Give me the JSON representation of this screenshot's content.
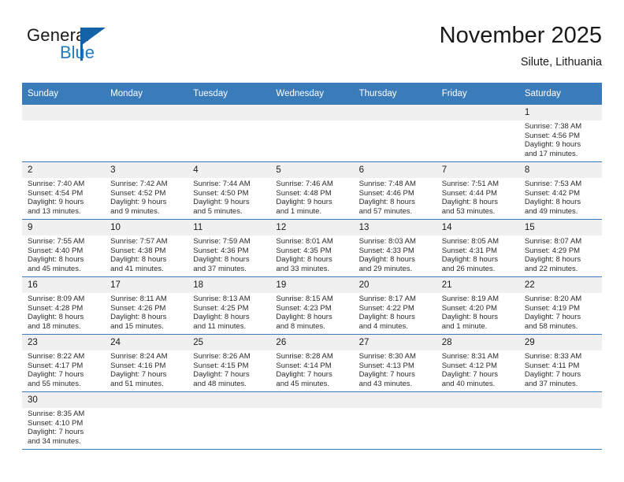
{
  "brand": {
    "word_one": "General",
    "word_two": "Blue",
    "flag_icon": "triangle-flag-icon"
  },
  "header": {
    "month_title": "November 2025",
    "location": "Silute, Lithuania"
  },
  "colors": {
    "header_blue": "#3a7cba",
    "brand_blue": "#1f7ac0",
    "daynum_band": "#f0f0f0",
    "text": "#1a1a1a"
  },
  "weekday_headers": [
    "Sunday",
    "Monday",
    "Tuesday",
    "Wednesday",
    "Thursday",
    "Friday",
    "Saturday"
  ],
  "weeks": [
    [
      {
        "day": "",
        "lines": []
      },
      {
        "day": "",
        "lines": []
      },
      {
        "day": "",
        "lines": []
      },
      {
        "day": "",
        "lines": []
      },
      {
        "day": "",
        "lines": []
      },
      {
        "day": "",
        "lines": []
      },
      {
        "day": "1",
        "lines": [
          "Sunrise: 7:38 AM",
          "Sunset: 4:56 PM",
          "Daylight: 9 hours",
          "and 17 minutes."
        ]
      }
    ],
    [
      {
        "day": "2",
        "lines": [
          "Sunrise: 7:40 AM",
          "Sunset: 4:54 PM",
          "Daylight: 9 hours",
          "and 13 minutes."
        ]
      },
      {
        "day": "3",
        "lines": [
          "Sunrise: 7:42 AM",
          "Sunset: 4:52 PM",
          "Daylight: 9 hours",
          "and 9 minutes."
        ]
      },
      {
        "day": "4",
        "lines": [
          "Sunrise: 7:44 AM",
          "Sunset: 4:50 PM",
          "Daylight: 9 hours",
          "and 5 minutes."
        ]
      },
      {
        "day": "5",
        "lines": [
          "Sunrise: 7:46 AM",
          "Sunset: 4:48 PM",
          "Daylight: 9 hours",
          "and 1 minute."
        ]
      },
      {
        "day": "6",
        "lines": [
          "Sunrise: 7:48 AM",
          "Sunset: 4:46 PM",
          "Daylight: 8 hours",
          "and 57 minutes."
        ]
      },
      {
        "day": "7",
        "lines": [
          "Sunrise: 7:51 AM",
          "Sunset: 4:44 PM",
          "Daylight: 8 hours",
          "and 53 minutes."
        ]
      },
      {
        "day": "8",
        "lines": [
          "Sunrise: 7:53 AM",
          "Sunset: 4:42 PM",
          "Daylight: 8 hours",
          "and 49 minutes."
        ]
      }
    ],
    [
      {
        "day": "9",
        "lines": [
          "Sunrise: 7:55 AM",
          "Sunset: 4:40 PM",
          "Daylight: 8 hours",
          "and 45 minutes."
        ]
      },
      {
        "day": "10",
        "lines": [
          "Sunrise: 7:57 AM",
          "Sunset: 4:38 PM",
          "Daylight: 8 hours",
          "and 41 minutes."
        ]
      },
      {
        "day": "11",
        "lines": [
          "Sunrise: 7:59 AM",
          "Sunset: 4:36 PM",
          "Daylight: 8 hours",
          "and 37 minutes."
        ]
      },
      {
        "day": "12",
        "lines": [
          "Sunrise: 8:01 AM",
          "Sunset: 4:35 PM",
          "Daylight: 8 hours",
          "and 33 minutes."
        ]
      },
      {
        "day": "13",
        "lines": [
          "Sunrise: 8:03 AM",
          "Sunset: 4:33 PM",
          "Daylight: 8 hours",
          "and 29 minutes."
        ]
      },
      {
        "day": "14",
        "lines": [
          "Sunrise: 8:05 AM",
          "Sunset: 4:31 PM",
          "Daylight: 8 hours",
          "and 26 minutes."
        ]
      },
      {
        "day": "15",
        "lines": [
          "Sunrise: 8:07 AM",
          "Sunset: 4:29 PM",
          "Daylight: 8 hours",
          "and 22 minutes."
        ]
      }
    ],
    [
      {
        "day": "16",
        "lines": [
          "Sunrise: 8:09 AM",
          "Sunset: 4:28 PM",
          "Daylight: 8 hours",
          "and 18 minutes."
        ]
      },
      {
        "day": "17",
        "lines": [
          "Sunrise: 8:11 AM",
          "Sunset: 4:26 PM",
          "Daylight: 8 hours",
          "and 15 minutes."
        ]
      },
      {
        "day": "18",
        "lines": [
          "Sunrise: 8:13 AM",
          "Sunset: 4:25 PM",
          "Daylight: 8 hours",
          "and 11 minutes."
        ]
      },
      {
        "day": "19",
        "lines": [
          "Sunrise: 8:15 AM",
          "Sunset: 4:23 PM",
          "Daylight: 8 hours",
          "and 8 minutes."
        ]
      },
      {
        "day": "20",
        "lines": [
          "Sunrise: 8:17 AM",
          "Sunset: 4:22 PM",
          "Daylight: 8 hours",
          "and 4 minutes."
        ]
      },
      {
        "day": "21",
        "lines": [
          "Sunrise: 8:19 AM",
          "Sunset: 4:20 PM",
          "Daylight: 8 hours",
          "and 1 minute."
        ]
      },
      {
        "day": "22",
        "lines": [
          "Sunrise: 8:20 AM",
          "Sunset: 4:19 PM",
          "Daylight: 7 hours",
          "and 58 minutes."
        ]
      }
    ],
    [
      {
        "day": "23",
        "lines": [
          "Sunrise: 8:22 AM",
          "Sunset: 4:17 PM",
          "Daylight: 7 hours",
          "and 55 minutes."
        ]
      },
      {
        "day": "24",
        "lines": [
          "Sunrise: 8:24 AM",
          "Sunset: 4:16 PM",
          "Daylight: 7 hours",
          "and 51 minutes."
        ]
      },
      {
        "day": "25",
        "lines": [
          "Sunrise: 8:26 AM",
          "Sunset: 4:15 PM",
          "Daylight: 7 hours",
          "and 48 minutes."
        ]
      },
      {
        "day": "26",
        "lines": [
          "Sunrise: 8:28 AM",
          "Sunset: 4:14 PM",
          "Daylight: 7 hours",
          "and 45 minutes."
        ]
      },
      {
        "day": "27",
        "lines": [
          "Sunrise: 8:30 AM",
          "Sunset: 4:13 PM",
          "Daylight: 7 hours",
          "and 43 minutes."
        ]
      },
      {
        "day": "28",
        "lines": [
          "Sunrise: 8:31 AM",
          "Sunset: 4:12 PM",
          "Daylight: 7 hours",
          "and 40 minutes."
        ]
      },
      {
        "day": "29",
        "lines": [
          "Sunrise: 8:33 AM",
          "Sunset: 4:11 PM",
          "Daylight: 7 hours",
          "and 37 minutes."
        ]
      }
    ],
    [
      {
        "day": "30",
        "lines": [
          "Sunrise: 8:35 AM",
          "Sunset: 4:10 PM",
          "Daylight: 7 hours",
          "and 34 minutes."
        ]
      },
      {
        "day": "",
        "lines": []
      },
      {
        "day": "",
        "lines": []
      },
      {
        "day": "",
        "lines": []
      },
      {
        "day": "",
        "lines": []
      },
      {
        "day": "",
        "lines": []
      },
      {
        "day": "",
        "lines": []
      }
    ]
  ]
}
